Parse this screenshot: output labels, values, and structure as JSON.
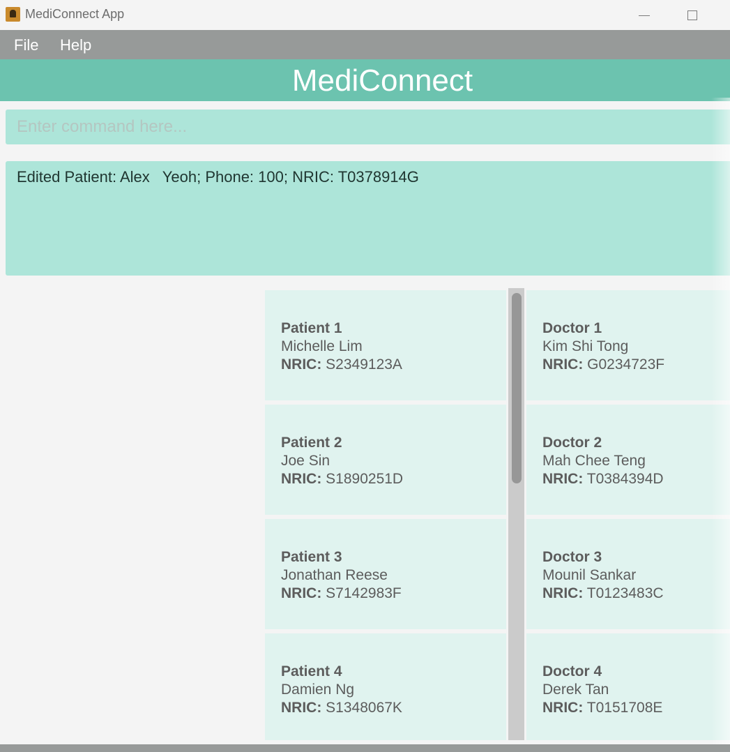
{
  "window": {
    "title": "MediConnect App"
  },
  "menu": {
    "file_label": "File",
    "help_label": "Help"
  },
  "banner": {
    "title": "MediConnect"
  },
  "command": {
    "placeholder": "Enter command here...",
    "value": ""
  },
  "result": {
    "message": "Edited Patient: Alex   Yeoh; Phone: 100; NRIC: T0378914G"
  },
  "nric_label": "NRIC:",
  "patients": [
    {
      "heading": "Patient 1",
      "name": "Michelle Lim",
      "nric": "S2349123A"
    },
    {
      "heading": "Patient 2",
      "name": "Joe Sin",
      "nric": "S1890251D"
    },
    {
      "heading": "Patient 3",
      "name": "Jonathan Reese",
      "nric": "S7142983F"
    },
    {
      "heading": "Patient 4",
      "name": "Damien Ng",
      "nric": "S1348067K"
    }
  ],
  "doctors": [
    {
      "heading": "Doctor 1",
      "name": "Kim Shi Tong",
      "nric": "G0234723F"
    },
    {
      "heading": "Doctor 2",
      "name": "Mah Chee Teng",
      "nric": "T0384394D"
    },
    {
      "heading": "Doctor 3",
      "name": "Mounil Sankar",
      "nric": "T0123483C"
    },
    {
      "heading": "Doctor 4",
      "name": "Derek Tan",
      "nric": "T0151708E"
    }
  ],
  "colors": {
    "accent": "#6cc3af",
    "panel": "#ade5d9",
    "card": "#e0f3ef",
    "menubar": "#979a99"
  }
}
